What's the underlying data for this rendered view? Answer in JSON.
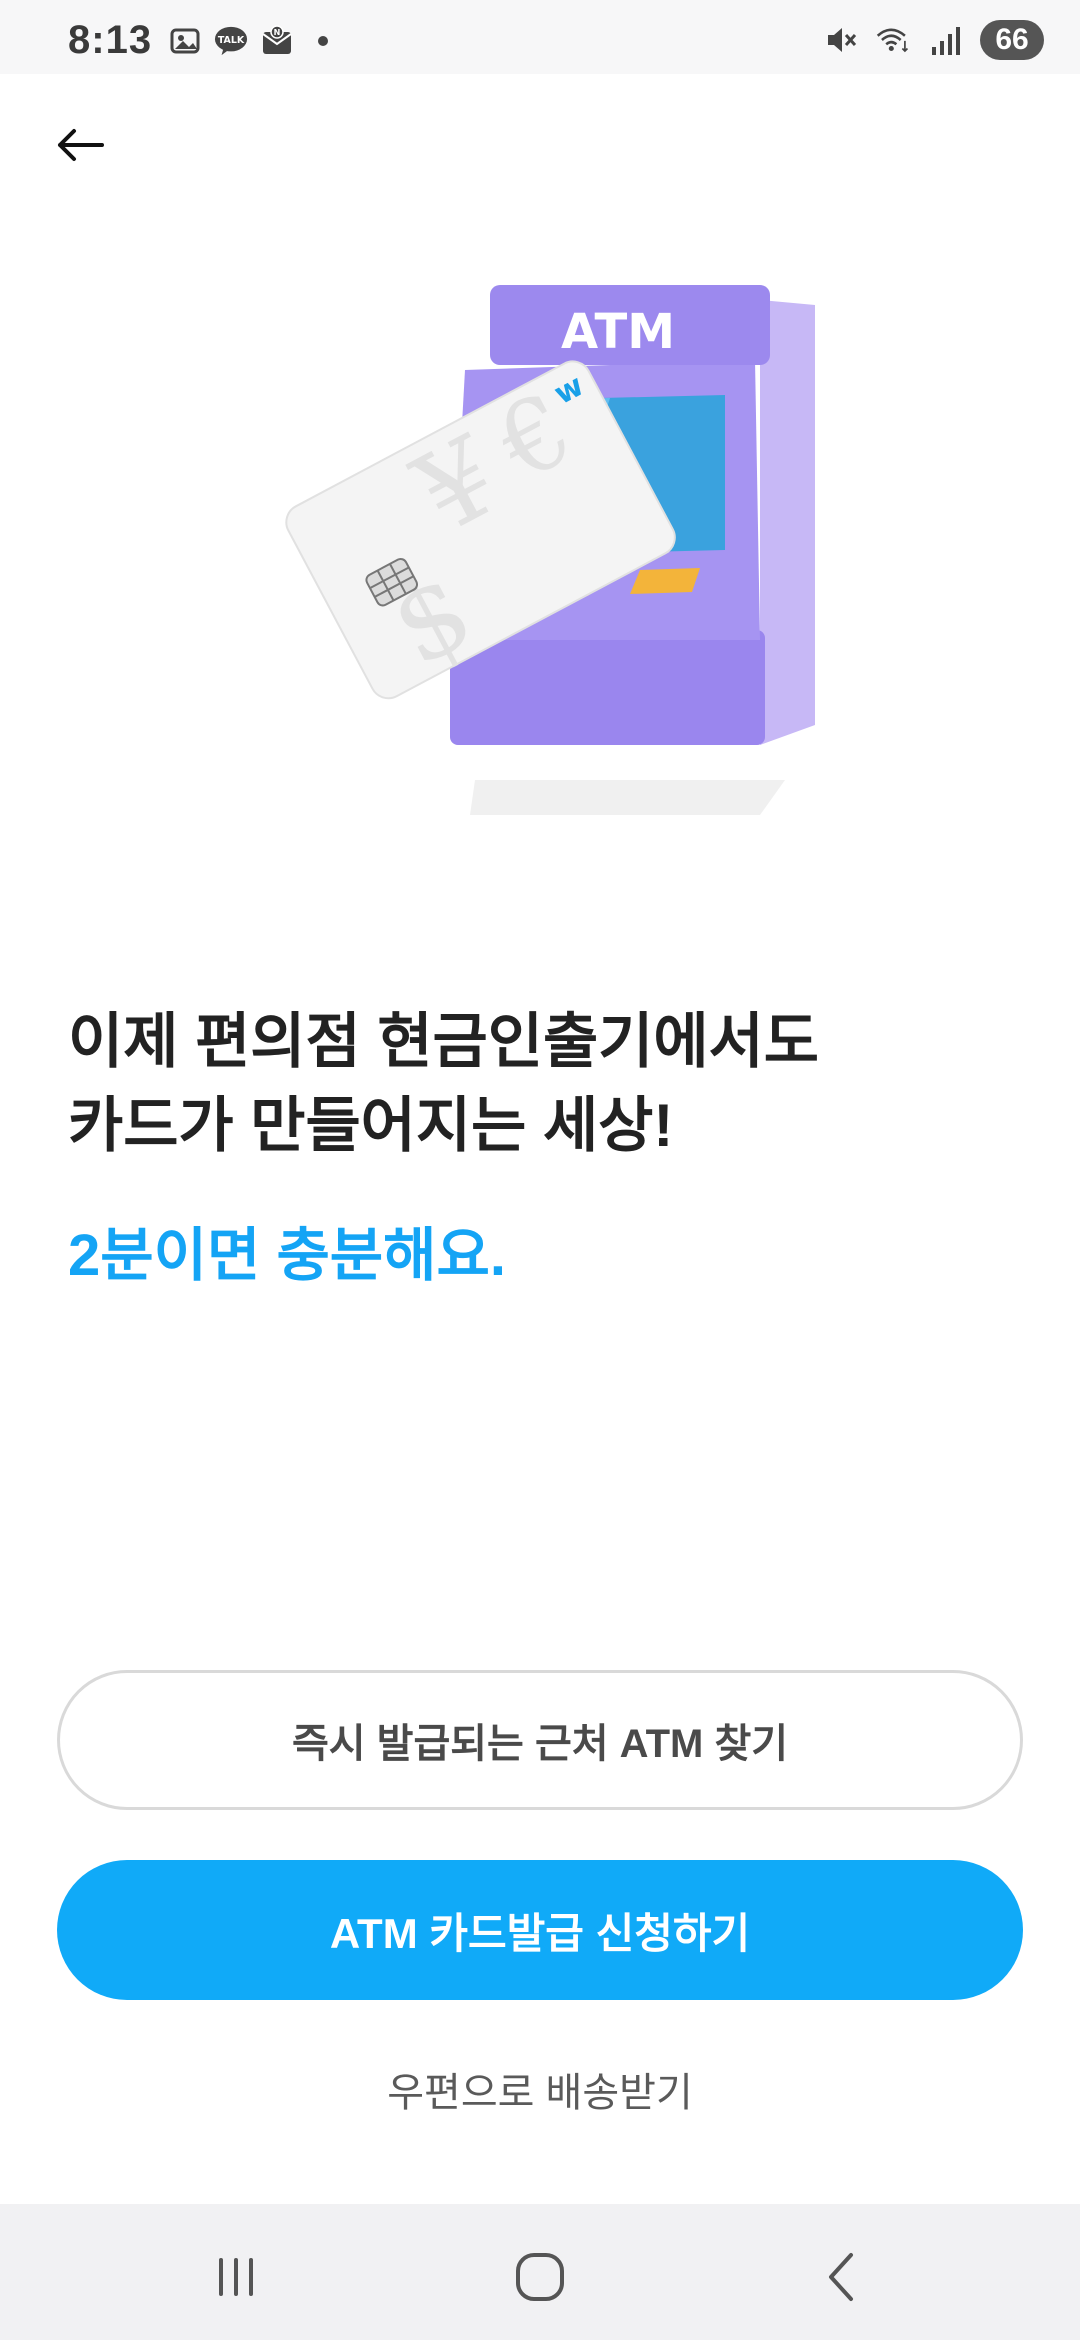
{
  "status_bar": {
    "time": "8:13",
    "left_icons": [
      "gallery-icon",
      "kakaotalk-icon",
      "naver-mail-icon",
      "dot-icon"
    ],
    "right_icons": [
      "mute-icon",
      "wifi-icon",
      "signal-icon"
    ],
    "battery": "66"
  },
  "header": {
    "back_icon": "back-arrow-icon"
  },
  "illustration": {
    "atm_label": "ATM",
    "card_logo": "w"
  },
  "content": {
    "headline_line1": "이제 편의점 현금인출기에서도",
    "headline_line2": "카드가 만들어지는 세상!",
    "subline": "2분이면 충분해요."
  },
  "actions": {
    "find_atm_label": "즉시 발급되는 근처 ATM 찾기",
    "apply_label": "ATM 카드발급 신청하기",
    "post_label": "우편으로 배송받기"
  },
  "nav_bar": {
    "icons": [
      "recent-apps-icon",
      "home-icon",
      "back-icon"
    ]
  },
  "colors": {
    "accent": "#10aaf8",
    "headline": "#222222",
    "atm": "#9a86ee"
  }
}
